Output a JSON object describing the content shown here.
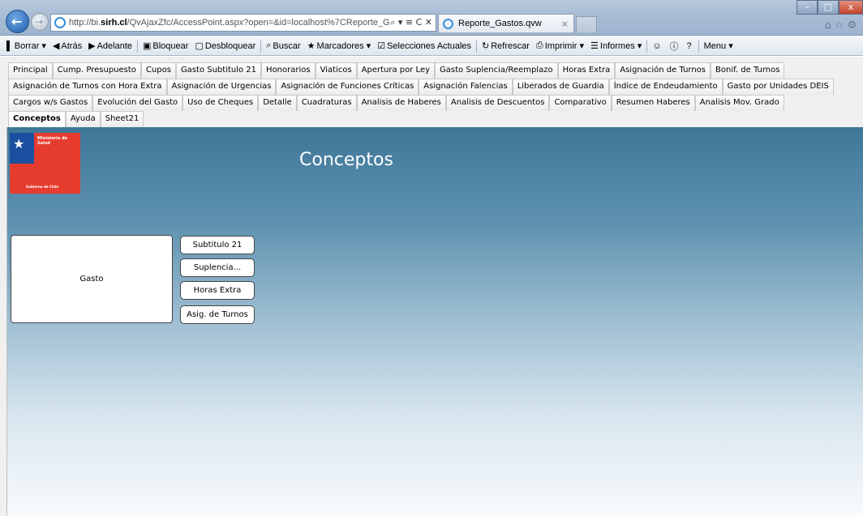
{
  "browser": {
    "url_prefix": "http://bi.",
    "url_domain": "sirh.cl",
    "url_rest": "/QvAjaxZfc/AccessPoint.aspx?open=&id=localhost%7CReporte_Gasto:",
    "address_icons": "⌕ ▾ ≡ C ✕",
    "tab_title": "Reporte_Gastos.qvw",
    "tab_close": "×",
    "win_minimize": "–",
    "win_maximize": "□",
    "win_close": "x",
    "right_icons": "⌂☆⚙"
  },
  "toolbar": [
    {
      "icon": "clear-icon",
      "glyph": "▌",
      "label": "Borrar ▾"
    },
    {
      "icon": "back-icon",
      "glyph": "◀",
      "label": "Atrás"
    },
    {
      "icon": "forward-icon",
      "glyph": "▶",
      "label": "Adelante"
    },
    {
      "icon": "lock-icon",
      "glyph": "▣",
      "label": "Bloquear"
    },
    {
      "icon": "unlock-icon",
      "glyph": "▢",
      "label": "Desbloquear"
    },
    {
      "icon": "search-icon",
      "glyph": "⌕",
      "label": "Buscar"
    },
    {
      "icon": "bookmark-icon",
      "glyph": "★",
      "label": "Marcadores ▾"
    },
    {
      "icon": "selections-icon",
      "glyph": "☑",
      "label": "Selecciones Actuales"
    },
    {
      "icon": "refresh-icon",
      "glyph": "↻",
      "label": "Refrescar"
    },
    {
      "icon": "print-icon",
      "glyph": "⎙",
      "label": "Imprimir ▾"
    },
    {
      "icon": "reports-icon",
      "glyph": "☰",
      "label": "Informes ▾"
    },
    {
      "icon": "users-icon",
      "glyph": "☺",
      "label": ""
    },
    {
      "icon": "help-icon",
      "glyph": "ⓘ",
      "label": ""
    },
    {
      "icon": "help-cursor-icon",
      "glyph": "?",
      "label": ""
    },
    {
      "icon": "menu-icon",
      "glyph": "",
      "label": "Menu ▾"
    }
  ],
  "tabs": {
    "row1": [
      "Principal",
      "Cump. Presupuesto",
      "Cupos",
      "Gasto Subtitulo 21",
      "Honorarios",
      "Viaticos",
      "Apertura por Ley",
      "Gasto Suplencia/Reemplazo",
      "Horas Extra",
      "Asignación de Turnos",
      "Bonif. de Turnos"
    ],
    "row2": [
      "Asignación de Turnos con Hora Extra",
      "Asignación de Urgencias",
      "Asignación de Funciones Críticas",
      "Asignación Falencias",
      "Liberados de Guardia",
      "Índice de Endeudamiento",
      "Gasto por Unidades DEIS"
    ],
    "row3": [
      "Cargos w/s Gastos",
      "Evolución del Gasto",
      "Uso de Cheques",
      "Detalle",
      "Cuadraturas",
      "Analisis de Haberes",
      "Analisis de Descuentos",
      "Comparativo",
      "Resumen Haberes",
      "Analisis Mov. Grado"
    ],
    "row4": [
      "Conceptos",
      "Ayuda",
      "Sheet21"
    ],
    "active": "Conceptos"
  },
  "sheet": {
    "title": "Conceptos",
    "logo_ministry": "Ministerio de Salud",
    "logo_government": "Gobierno de Chile",
    "gasto_label": "Gasto",
    "buttons": [
      "Subtitulo 21",
      "Suplencia...",
      "Horas Extra",
      "Asig. de Turnos"
    ]
  },
  "colors": {
    "sheet_top": "#3f7799",
    "sheet_bottom": "#f8fbfd",
    "logo_red": "#e53c2e",
    "logo_blue": "#1b4fa0"
  }
}
